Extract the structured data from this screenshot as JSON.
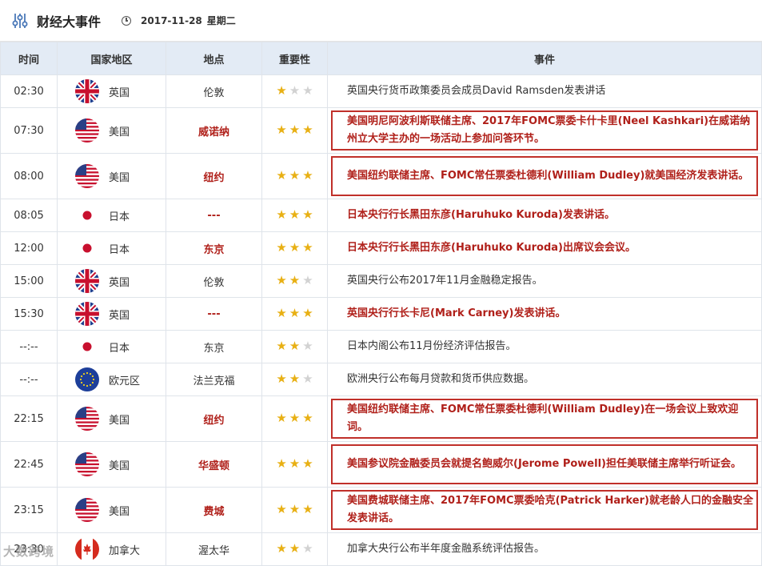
{
  "header": {
    "title": "财经大事件",
    "date": "2017-11-28",
    "weekday": "星期二"
  },
  "columns": [
    "时间",
    "国家地区",
    "地点",
    "重要性",
    "事件"
  ],
  "colors": {
    "accent_red": "#b0201a",
    "star_on": "#e8b014",
    "star_off": "#d2d2d2",
    "header_bg": "#e3ebf5"
  },
  "rows": [
    {
      "time": "02:30",
      "flag": "uk-flag",
      "country": "英国",
      "place": "伦敦",
      "stars": 1,
      "highlight": false,
      "place_red": false,
      "event": "英国央行货币政策委员会成员David Ramsden发表讲话"
    },
    {
      "time": "07:30",
      "flag": "us-flag",
      "country": "美国",
      "place": "威诺纳",
      "stars": 3,
      "highlight": true,
      "place_red": true,
      "event": "美国明尼阿波利斯联储主席、2017年FOMC票委卡什卡里(Neel Kashkari)在威诺纳州立大学主办的一场活动上参加问答环节。"
    },
    {
      "time": "08:00",
      "flag": "us-flag",
      "country": "美国",
      "place": "纽约",
      "stars": 3,
      "highlight": true,
      "place_red": true,
      "event": "美国纽约联储主席、FOMC常任票委杜德利(William Dudley)就美国经济发表讲话。"
    },
    {
      "time": "08:05",
      "flag": "jp-flag",
      "country": "日本",
      "place": "---",
      "stars": 3,
      "highlight": false,
      "place_red": true,
      "event_red": true,
      "event": "日本央行行长黑田东彦(Haruhuko Kuroda)发表讲话。"
    },
    {
      "time": "12:00",
      "flag": "jp-flag",
      "country": "日本",
      "place": "东京",
      "stars": 3,
      "highlight": false,
      "place_red": true,
      "event_red": true,
      "event": "日本央行行长黑田东彦(Haruhuko Kuroda)出席议会会议。"
    },
    {
      "time": "15:00",
      "flag": "uk-flag",
      "country": "英国",
      "place": "伦敦",
      "stars": 2,
      "highlight": false,
      "place_red": false,
      "event": "英国央行公布2017年11月金融稳定报告。"
    },
    {
      "time": "15:30",
      "flag": "uk-flag",
      "country": "英国",
      "place": "---",
      "stars": 3,
      "highlight": false,
      "place_red": true,
      "event_red": true,
      "event": "英国央行行长卡尼(Mark Carney)发表讲话。"
    },
    {
      "time": "--:--",
      "flag": "jp-flag",
      "country": "日本",
      "place": "东京",
      "stars": 2,
      "highlight": false,
      "place_red": false,
      "event": "日本内阁公布11月份经济评估报告。"
    },
    {
      "time": "--:--",
      "flag": "eu-flag",
      "country": "欧元区",
      "place": "法兰克福",
      "stars": 2,
      "highlight": false,
      "place_red": false,
      "event": "欧洲央行公布每月贷款和货币供应数据。"
    },
    {
      "time": "22:15",
      "flag": "us-flag",
      "country": "美国",
      "place": "纽约",
      "stars": 3,
      "highlight": true,
      "place_red": true,
      "event": "美国纽约联储主席、FOMC常任票委杜德利(William Dudley)在一场会议上致欢迎词。"
    },
    {
      "time": "22:45",
      "flag": "us-flag",
      "country": "美国",
      "place": "华盛顿",
      "stars": 3,
      "highlight": true,
      "place_red": true,
      "event": "美国参议院金融委员会就提名鲍威尔(Jerome Powell)担任美联储主席举行听证会。"
    },
    {
      "time": "23:15",
      "flag": "us-flag",
      "country": "美国",
      "place": "费城",
      "stars": 3,
      "highlight": true,
      "place_red": true,
      "event": "美国费城联储主席、2017年FOMC票委哈克(Patrick Harker)就老龄人口的金融安全发表讲话。"
    },
    {
      "time": "23:30",
      "flag": "ca-flag",
      "country": "加拿大",
      "place": "渥太华",
      "stars": 2,
      "highlight": false,
      "place_red": false,
      "event": "加拿大央行公布半年度金融系统评估报告。"
    }
  ],
  "watermark": "大数跨境"
}
